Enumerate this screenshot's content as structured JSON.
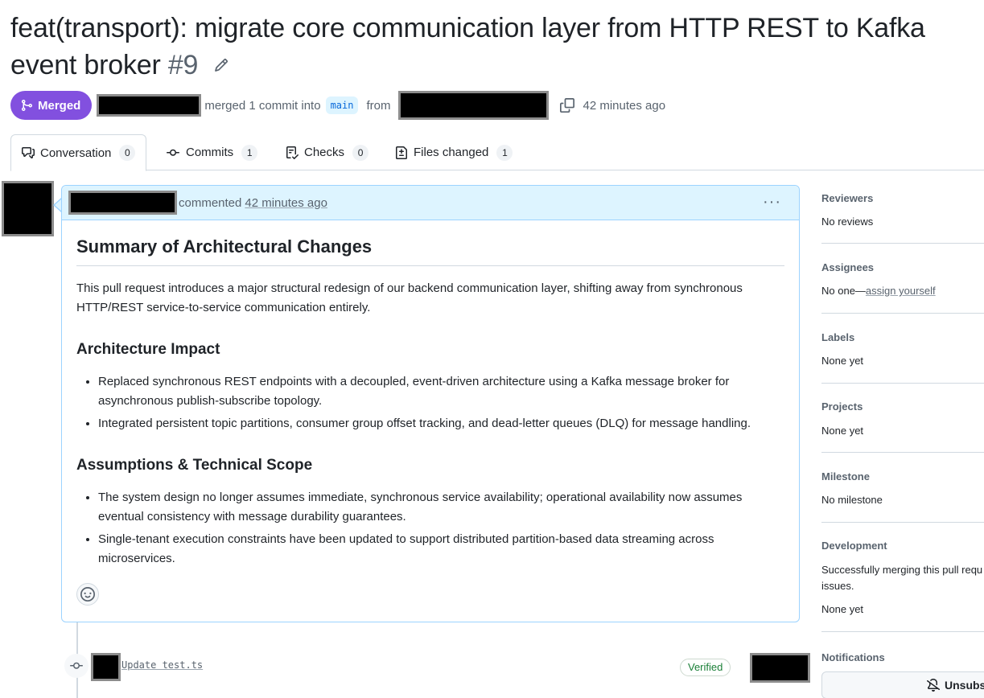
{
  "pr": {
    "title": "feat(transport): migrate core communication layer from HTTP REST to Kafka event broker",
    "number": "#9",
    "state": "Merged",
    "merged_text": "merged 1 commit into",
    "base_branch": "main",
    "from_text": "from",
    "time_ago": "42 minutes ago"
  },
  "tabs": [
    {
      "label": "Conversation",
      "count": "0",
      "icon": "conversation-icon"
    },
    {
      "label": "Commits",
      "count": "1",
      "icon": "commit-icon"
    },
    {
      "label": "Checks",
      "count": "0",
      "icon": "checklist-icon"
    },
    {
      "label": "Files changed",
      "count": "1",
      "icon": "file-diff-icon"
    }
  ],
  "comment": {
    "action": "commented",
    "time": "42 minutes ago",
    "heading": "Summary of Architectural Changes",
    "intro": "This pull request introduces a major structural redesign of our backend communication layer, shifting away from synchronous HTTP/REST service-to-service communication entirely.",
    "sections": [
      {
        "title": "Architecture Impact",
        "items": [
          "Replaced synchronous REST endpoints with a decoupled, event-driven architecture using a Kafka message broker for asynchronous publish-subscribe topology.",
          "Integrated persistent topic partitions, consumer group offset tracking, and dead-letter queues (DLQ) for message handling."
        ]
      },
      {
        "title": "Assumptions & Technical Scope",
        "items": [
          "The system design no longer assumes immediate, synchronous service availability; operational availability now assumes eventual consistency with message durability guarantees.",
          "Single-tenant execution constraints have been updated to support distributed partition-based data streaming across microservices."
        ]
      }
    ]
  },
  "timeline": {
    "commit_message": "Update test.ts",
    "verified_label": "Verified"
  },
  "sidebar": {
    "reviewers": {
      "label": "Reviewers",
      "value": "No reviews"
    },
    "assignees": {
      "label": "Assignees",
      "value": "No one—",
      "link": "assign yourself"
    },
    "labels": {
      "label": "Labels",
      "value": "None yet"
    },
    "projects": {
      "label": "Projects",
      "value": "None yet"
    },
    "milestone": {
      "label": "Milestone",
      "value": "No milestone"
    },
    "development": {
      "label": "Development",
      "line1": "Successfully merging this pull requ",
      "line2": "issues.",
      "value": "None yet"
    },
    "notifications": {
      "label": "Notifications",
      "button": "Unsubsc"
    }
  },
  "colors": {
    "merged_purple": "#8250df",
    "comment_header_bg": "#ddf4ff",
    "verified_green": "#1a7f37",
    "branch_blue": "#0969da"
  }
}
